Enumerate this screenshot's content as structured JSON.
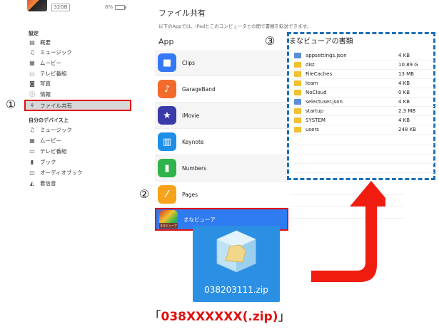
{
  "device": {
    "capacity": "32GB",
    "battery": "8%"
  },
  "sidebar": {
    "settings_label": "設定",
    "settings_items": [
      {
        "label": "概要",
        "icon": "summary-icon",
        "glyph": "▤"
      },
      {
        "label": "ミュージック",
        "icon": "music-icon",
        "glyph": "♫"
      },
      {
        "label": "ムービー",
        "icon": "movie-icon",
        "glyph": "▦"
      },
      {
        "label": "テレビ番組",
        "icon": "tv-icon",
        "glyph": "▭"
      },
      {
        "label": "写真",
        "icon": "camera-icon",
        "glyph": "◙"
      },
      {
        "label": "情報",
        "icon": "info-icon",
        "glyph": "ⓘ"
      },
      {
        "label": "ファイル共有",
        "icon": "file-sharing-icon",
        "glyph": "⚘"
      }
    ],
    "device_label": "自分のデバイス上",
    "device_items": [
      {
        "label": "ミュージック",
        "icon": "music-icon",
        "glyph": "♫"
      },
      {
        "label": "ムービー",
        "icon": "movie-icon",
        "glyph": "▦"
      },
      {
        "label": "テレビ番組",
        "icon": "tv-icon",
        "glyph": "▭"
      },
      {
        "label": "ブック",
        "icon": "book-icon",
        "glyph": "▮"
      },
      {
        "label": "オーディオブック",
        "icon": "audiobook-icon",
        "glyph": "◫"
      },
      {
        "label": "着信音",
        "icon": "bell-icon",
        "glyph": "◭"
      }
    ]
  },
  "main": {
    "title": "ファイル共有",
    "description": "以下のAppでは、iPadとこのコンピュータとの間で書類を転送できます。",
    "apps_header": "App",
    "apps": [
      {
        "name": "Clips",
        "icon": "clips-icon",
        "color": "#3478f6"
      },
      {
        "name": "GarageBand",
        "icon": "garageband-icon",
        "color": "#f26b2a"
      },
      {
        "name": "iMovie",
        "icon": "imovie-icon",
        "color": "#3a3aa8"
      },
      {
        "name": "Keynote",
        "icon": "keynote-icon",
        "color": "#1e8fe8"
      },
      {
        "name": "Numbers",
        "icon": "numbers-icon",
        "color": "#2fb34a"
      },
      {
        "name": "Pages",
        "icon": "pages-icon",
        "color": "#f7a21b"
      },
      {
        "name": "まなビューア",
        "icon": "manaviewer-icon",
        "color": "#7a3c2a"
      }
    ],
    "manaviewer_icon_text": "まなビューア"
  },
  "documents": {
    "title": "まなビューアの書類",
    "files": [
      {
        "name": "appsettings.json",
        "size": "4 KB",
        "type": "json"
      },
      {
        "name": "dist",
        "size": "10.89 G",
        "type": "folder"
      },
      {
        "name": "FileCaches",
        "size": "13 MB",
        "type": "folder"
      },
      {
        "name": "learn",
        "size": "4 KB",
        "type": "folder"
      },
      {
        "name": "NoCloud",
        "size": "0 KB",
        "type": "folder"
      },
      {
        "name": "selectuser.json",
        "size": "4 KB",
        "type": "json"
      },
      {
        "name": "startup",
        "size": "2.3 MB",
        "type": "folder"
      },
      {
        "name": "SYSTEM",
        "size": "4 KB",
        "type": "folder"
      },
      {
        "name": "users",
        "size": "248 KB",
        "type": "folder"
      }
    ]
  },
  "annotations": {
    "step1": "①",
    "step2": "②",
    "step3": "③"
  },
  "zip": {
    "filename": "038203111.zip"
  },
  "caption": {
    "open": "「",
    "highlight": "038XXXXXX(.zip)",
    "close": "」"
  },
  "colors": {
    "highlight_red": "#e01010",
    "dashed_blue": "#1b6fb8",
    "selection_blue": "#2f7bf0",
    "zip_bg": "#2b8fe3"
  }
}
